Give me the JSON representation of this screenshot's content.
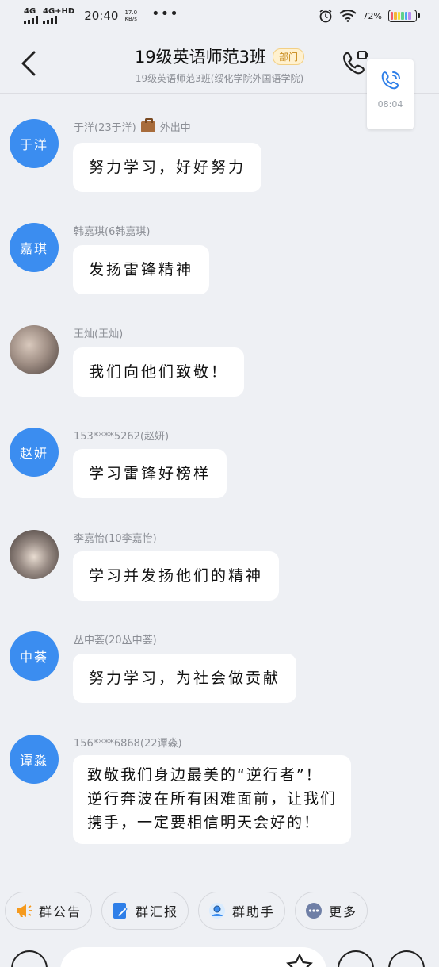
{
  "status_bar": {
    "network_1": "4G",
    "network_2": "4G+HD",
    "time": "20:40",
    "speed_value": "17.0",
    "speed_unit": "KB/s",
    "more": "•••",
    "battery": "72%"
  },
  "header": {
    "title": "19级英语师范3班",
    "badge": "部门",
    "subtitle": "19级英语师范3班(绥化学院外国语学院)"
  },
  "floating_call": {
    "duration": "08:04"
  },
  "messages": [
    {
      "avatar_text": "于洋",
      "sender": "于洋(23于洋)",
      "status": "外出中",
      "text": [
        "努力学习，好好努力"
      ]
    },
    {
      "avatar_text": "嘉琪",
      "sender": "韩嘉琪(6韩嘉琪)",
      "text": [
        "发扬雷锋精神"
      ]
    },
    {
      "avatar_text": "",
      "sender": "王灿(王灿)",
      "text": [
        "我们向他们致敬！"
      ]
    },
    {
      "avatar_text": "赵妍",
      "sender": "153****5262(赵妍)",
      "text": [
        "学习雷锋好榜样"
      ]
    },
    {
      "avatar_text": "",
      "sender": "李嘉怡(10李嘉怡)",
      "text": [
        "学习并发扬他们的精神"
      ]
    },
    {
      "avatar_text": "中荟",
      "sender": "丛中荟(20丛中荟)",
      "text": [
        "努力学习，为社会做贡献"
      ]
    },
    {
      "avatar_text": "谭淼",
      "sender": "156****6868(22谭淼)",
      "text": [
        "致敬我们身边最美的“逆行者”！",
        "逆行奔波在所有困难面前，让我们",
        "携手，一定要相信明天会好的！"
      ]
    }
  ],
  "quick_actions": [
    {
      "label": "群公告",
      "icon": "megaphone-icon",
      "color": "#f59a1e"
    },
    {
      "label": "群汇报",
      "icon": "report-icon",
      "color": "#2f7fe8"
    },
    {
      "label": "群助手",
      "icon": "assistant-icon",
      "color": "#3b8df0"
    },
    {
      "label": "更多",
      "icon": "more-icon",
      "color": "#6f7fa6"
    }
  ],
  "colors": {
    "accent": "#3b8df0",
    "background": "#eef0f4",
    "bubble": "#ffffff"
  }
}
